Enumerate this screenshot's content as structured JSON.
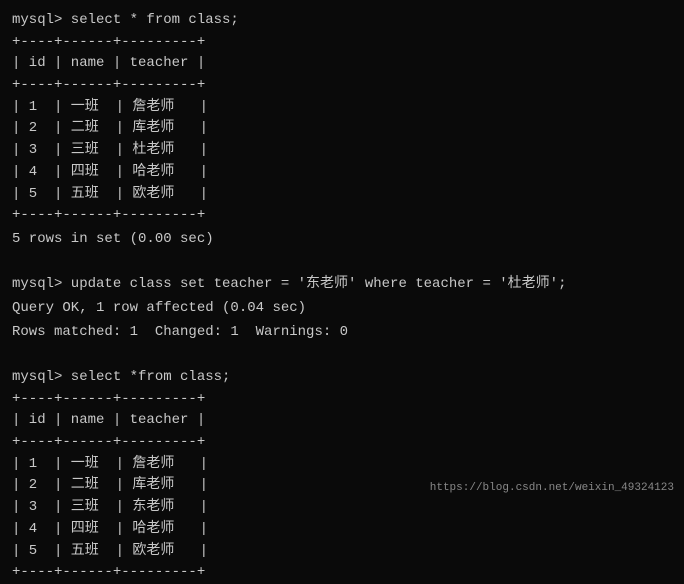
{
  "terminal": {
    "block1": {
      "prompt": "mysql> select * from class;",
      "separator1": "+----+------+---------+",
      "header": "| id | name | teacher |",
      "separator2": "+----+------+---------+",
      "rows": [
        "| 1  | 一班  | 詹老师   |",
        "| 2  | 二班  | 库老师   |",
        "| 3  | 三班  | 杜老师   |",
        "| 4  | 四班  | 哈老师   |",
        "| 5  | 五班  | 欧老师   |"
      ],
      "separator3": "+----+------+---------+",
      "rowcount": "5 rows in set (0.00 sec)"
    },
    "block2": {
      "prompt": "mysql> update class set teacher = '东老师' where teacher = '杜老师';",
      "ok": "Query OK, 1 row affected (0.04 sec)",
      "matched": "Rows matched: 1  Changed: 1  Warnings: 0"
    },
    "block3": {
      "prompt": "mysql> select *from class;",
      "separator1": "+----+------+---------+",
      "header": "| id | name | teacher |",
      "separator2": "+----+------+---------+",
      "rows": [
        "| 1  | 一班  | 詹老师   |",
        "| 2  | 二班  | 库老师   |",
        "| 3  | 三班  | 东老师   |",
        "| 4  | 四班  | 哈老师   |",
        "| 5  | 五班  | 欧老师   |"
      ],
      "separator3": "+----+------+---------+"
    },
    "watermark": "https://blog.csdn.net/weixin_49324123"
  }
}
